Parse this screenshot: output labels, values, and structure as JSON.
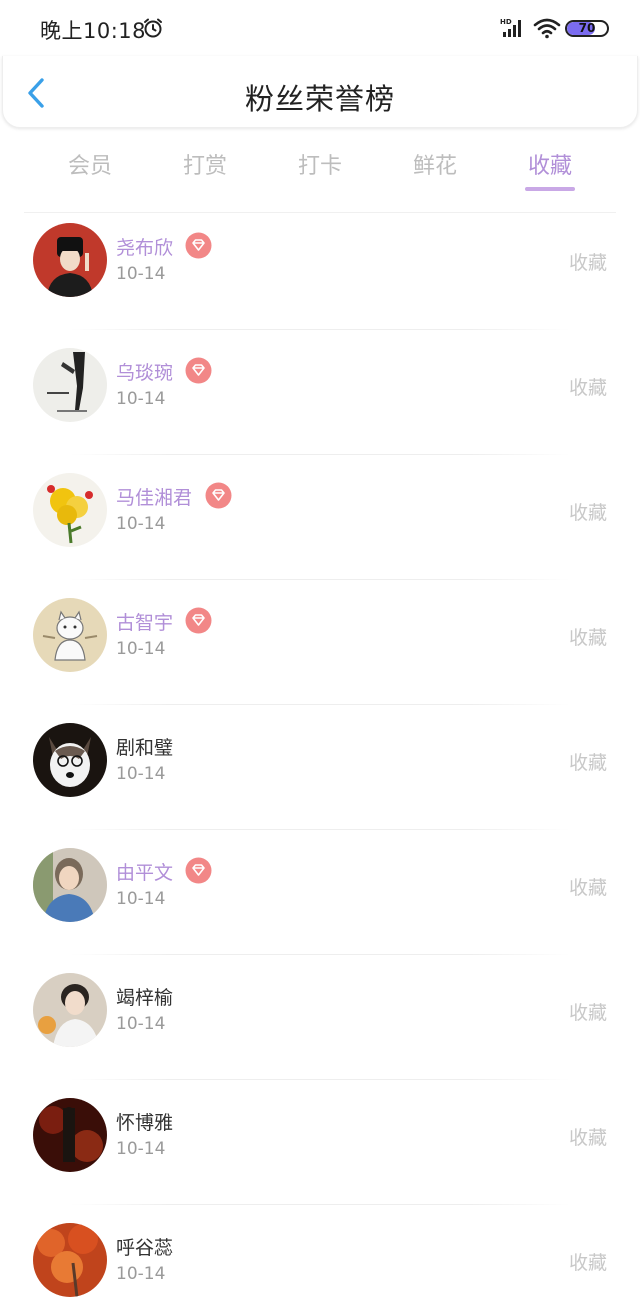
{
  "status_bar": {
    "time": "晚上10:18",
    "battery": "70",
    "battery_level": 0.7,
    "network_badge": "HD"
  },
  "header": {
    "title": "粉丝荣誉榜"
  },
  "tabs": [
    {
      "label": "会员",
      "active": false
    },
    {
      "label": "打赏",
      "active": false
    },
    {
      "label": "打卡",
      "active": false
    },
    {
      "label": "鲜花",
      "active": false
    },
    {
      "label": "收藏",
      "active": true
    }
  ],
  "accent_color": "#b18fd8",
  "vip_badge_color": "#f28787",
  "fans": [
    {
      "name": "尧布欣",
      "date": "10-14",
      "action": "收藏",
      "vip": true,
      "avatar": "woman-illustration-avatar"
    },
    {
      "name": "乌琰琬",
      "date": "10-14",
      "action": "收藏",
      "vip": true,
      "avatar": "figure-sketch-avatar"
    },
    {
      "name": "马佳湘君",
      "date": "10-14",
      "action": "收藏",
      "vip": true,
      "avatar": "yellow-flowers-avatar"
    },
    {
      "name": "古智宇",
      "date": "10-14",
      "action": "收藏",
      "vip": true,
      "avatar": "cartoon-cat-avatar"
    },
    {
      "name": "剧和璧",
      "date": "10-14",
      "action": "收藏",
      "vip": false,
      "avatar": "husky-dog-avatar"
    },
    {
      "name": "由平文",
      "date": "10-14",
      "action": "收藏",
      "vip": true,
      "avatar": "woman-photo-avatar"
    },
    {
      "name": "竭梓榆",
      "date": "10-14",
      "action": "收藏",
      "vip": false,
      "avatar": "young-man-avatar"
    },
    {
      "name": "怀博雅",
      "date": "10-14",
      "action": "收藏",
      "vip": false,
      "avatar": "dark-red-scene-avatar"
    },
    {
      "name": "呼谷蕊",
      "date": "10-14",
      "action": "收藏",
      "vip": false,
      "avatar": "autumn-leaves-avatar"
    }
  ]
}
